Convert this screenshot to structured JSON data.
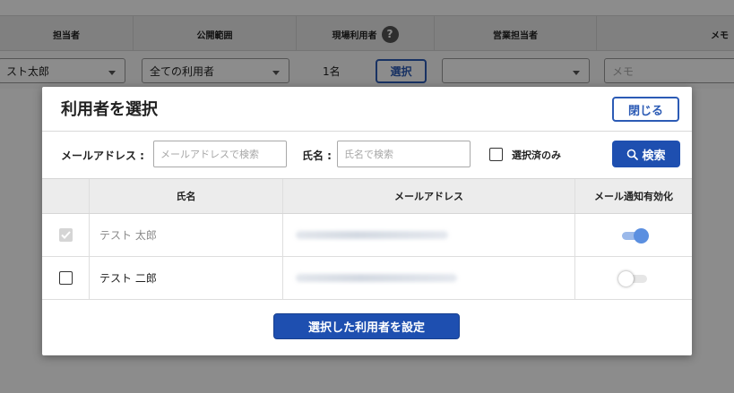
{
  "background": {
    "headers": {
      "owner": "担当者",
      "scope": "公開範囲",
      "site_users": "現場利用者",
      "sales_owner": "営業担当者",
      "memo": "メモ"
    },
    "row": {
      "owner_value": "スト太郎",
      "scope_value": "全ての利用者",
      "user_count": "1名",
      "select_label": "選択",
      "memo_placeholder": "メモ"
    },
    "help_icon": "?"
  },
  "modal": {
    "title": "利用者を選択",
    "close_label": "閉じる",
    "search": {
      "email_label": "メールアドレス :",
      "email_placeholder": "メールアドレスで検索",
      "name_label": "氏名 :",
      "name_placeholder": "氏名で検索",
      "selected_only_label": "選択済のみ",
      "search_label": "検索"
    },
    "table": {
      "columns": [
        "",
        "氏名",
        "メールアドレス",
        "メール通知有効化"
      ],
      "rows": [
        {
          "checked": true,
          "name": "テスト 太郎",
          "notify": true
        },
        {
          "checked": false,
          "name": "テスト 二郎",
          "notify": false
        }
      ]
    },
    "apply_label": "選択した利用者を設定"
  },
  "colors": {
    "accent": "#1e4fb0",
    "toggle_on": "#5b8fe0"
  }
}
